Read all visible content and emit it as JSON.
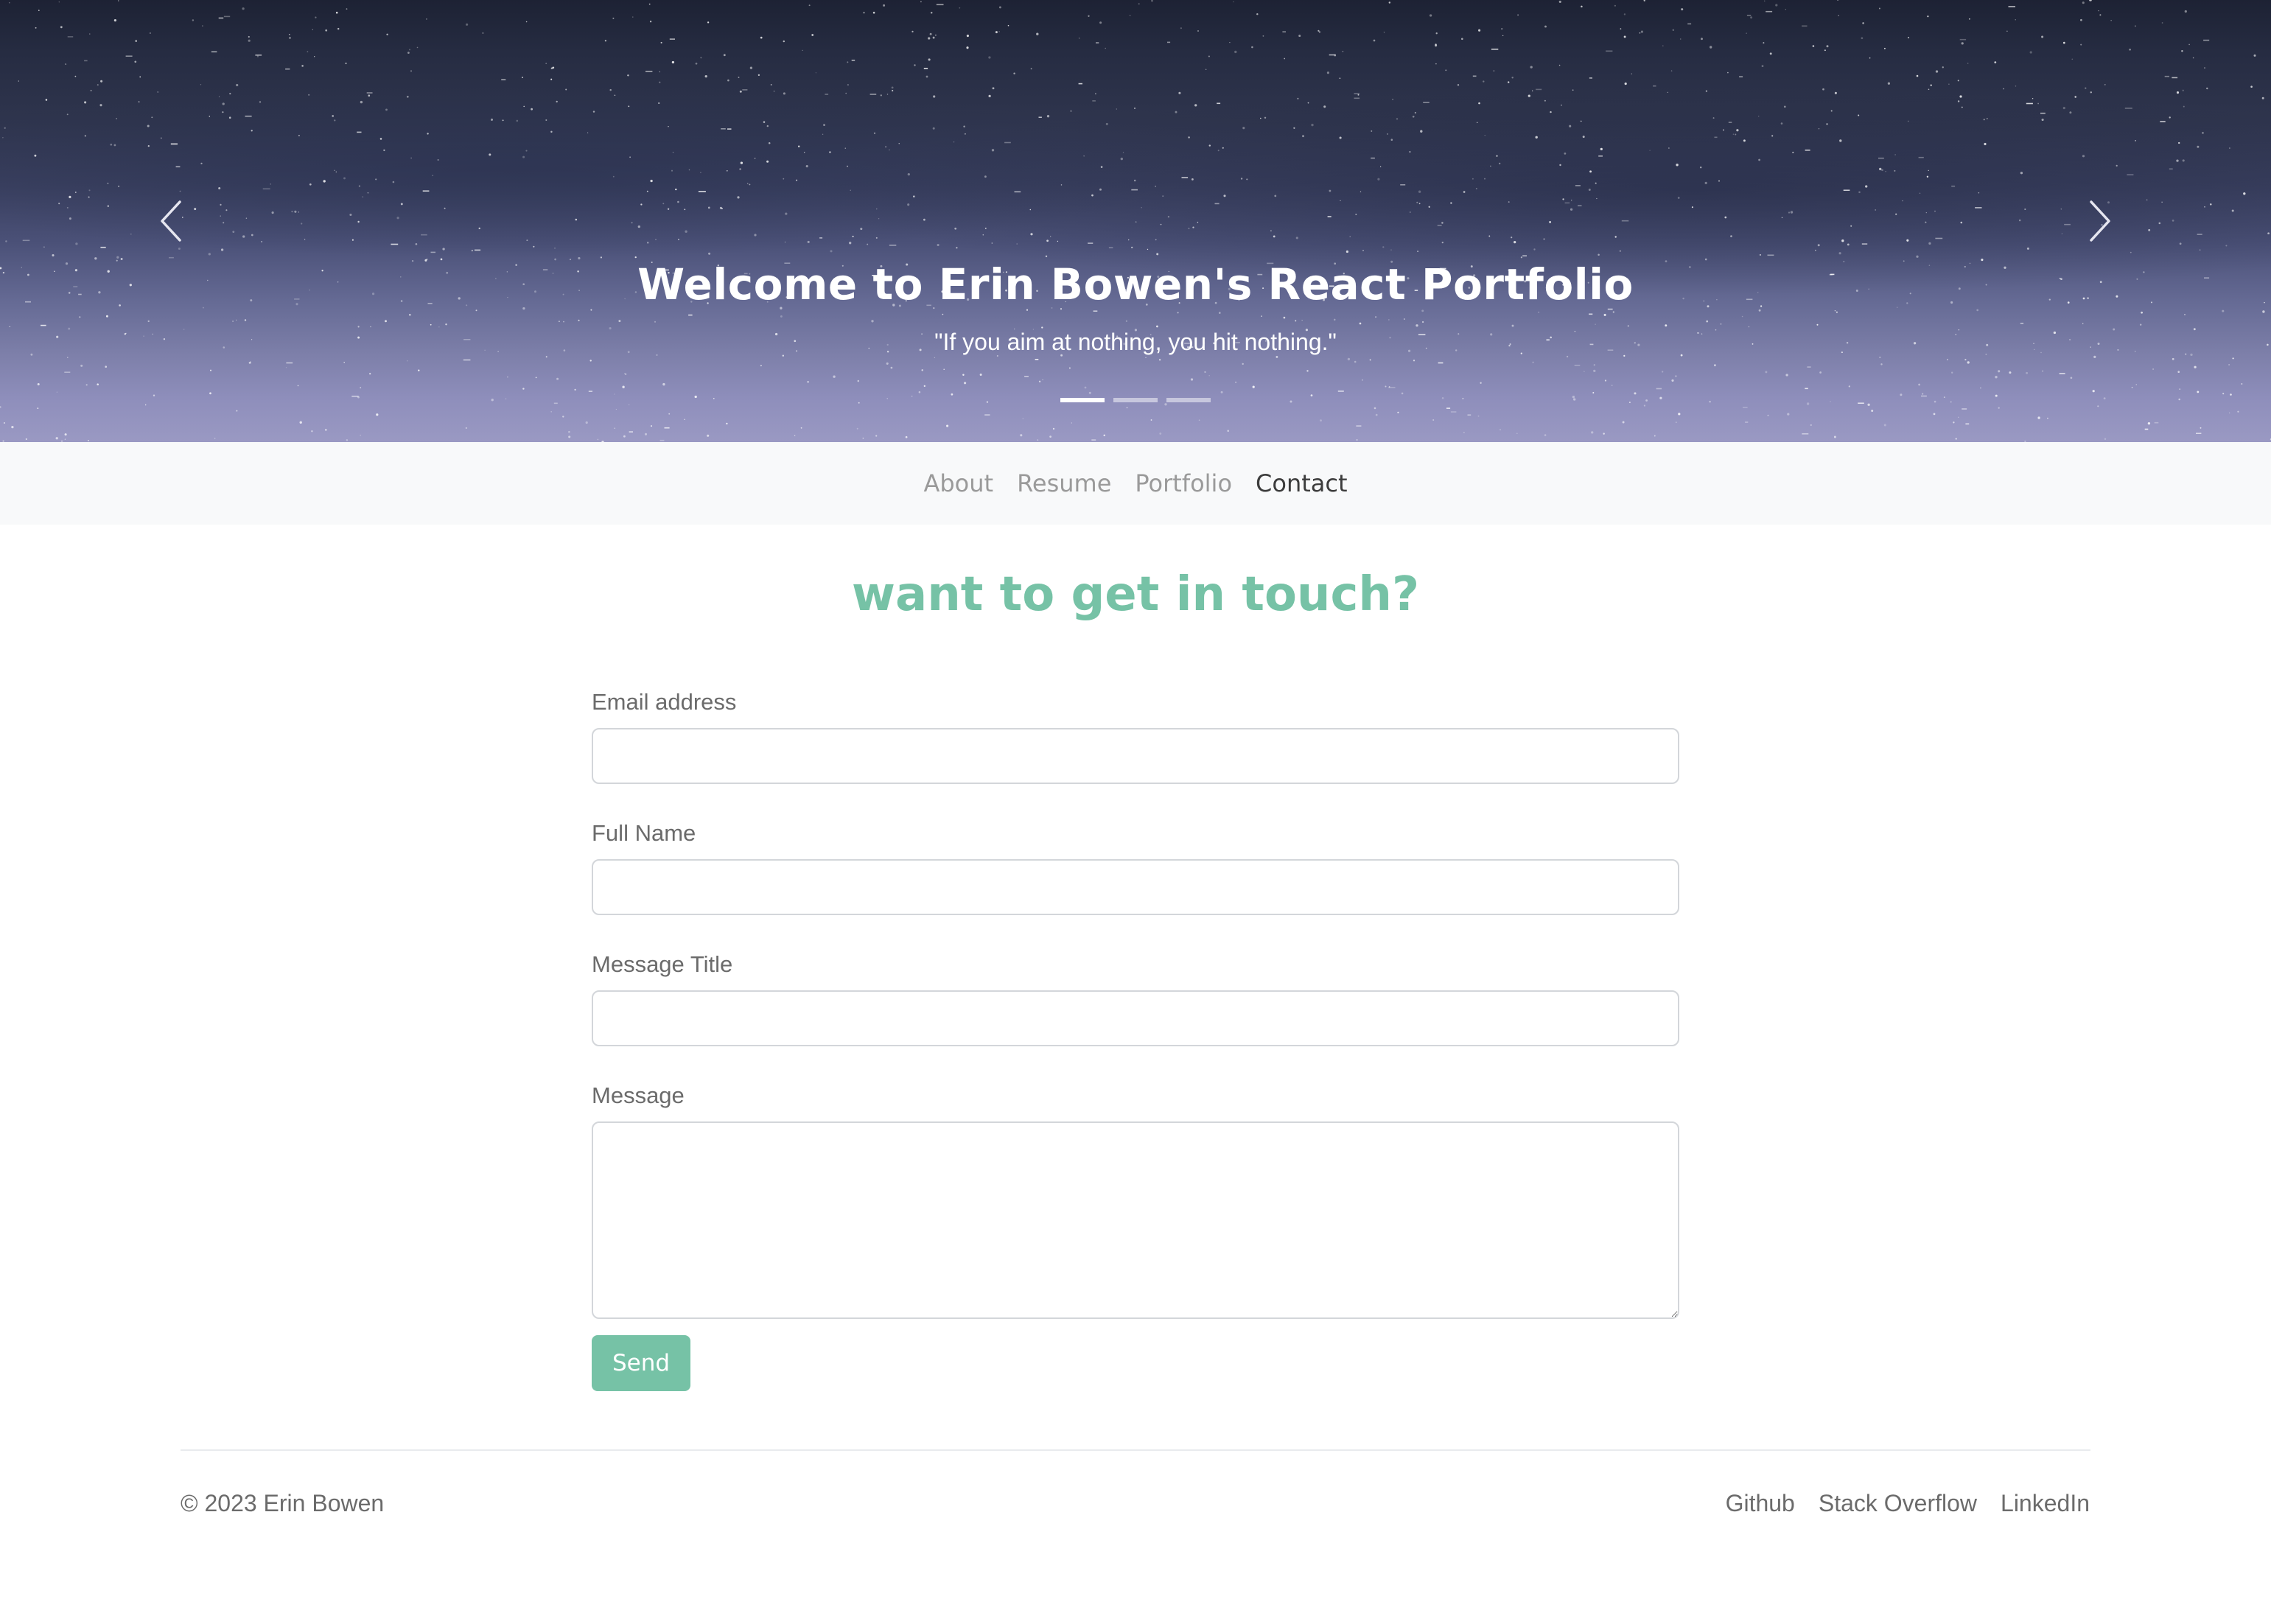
{
  "hero": {
    "title": "Welcome to Erin Bowen's React Portfolio",
    "quote": "\"If you aim at nothing, you hit nothing.\"",
    "slide_count": 3,
    "active_slide": 1,
    "prev_icon": "chevron-left-icon",
    "next_icon": "chevron-right-icon"
  },
  "nav": {
    "items": [
      {
        "label": "About",
        "active": false
      },
      {
        "label": "Resume",
        "active": false
      },
      {
        "label": "Portfolio",
        "active": false
      },
      {
        "label": "Contact",
        "active": true
      }
    ]
  },
  "contact": {
    "title": "want to get in touch?",
    "fields": {
      "email_label": "Email address",
      "email_value": "",
      "name_label": "Full Name",
      "name_value": "",
      "subject_label": "Message Title",
      "subject_value": "",
      "message_label": "Message",
      "message_value": ""
    },
    "send_label": "Send"
  },
  "footer": {
    "copyright": "© 2023 Erin Bowen",
    "links": [
      "Github",
      "Stack Overflow",
      "LinkedIn"
    ]
  },
  "colors": {
    "accent": "#76c2a6",
    "nav_background": "#f8f9fa",
    "nav_inactive": "#9a9a9a",
    "nav_active": "#3c3c3c",
    "text_muted": "#6b6b6b"
  }
}
